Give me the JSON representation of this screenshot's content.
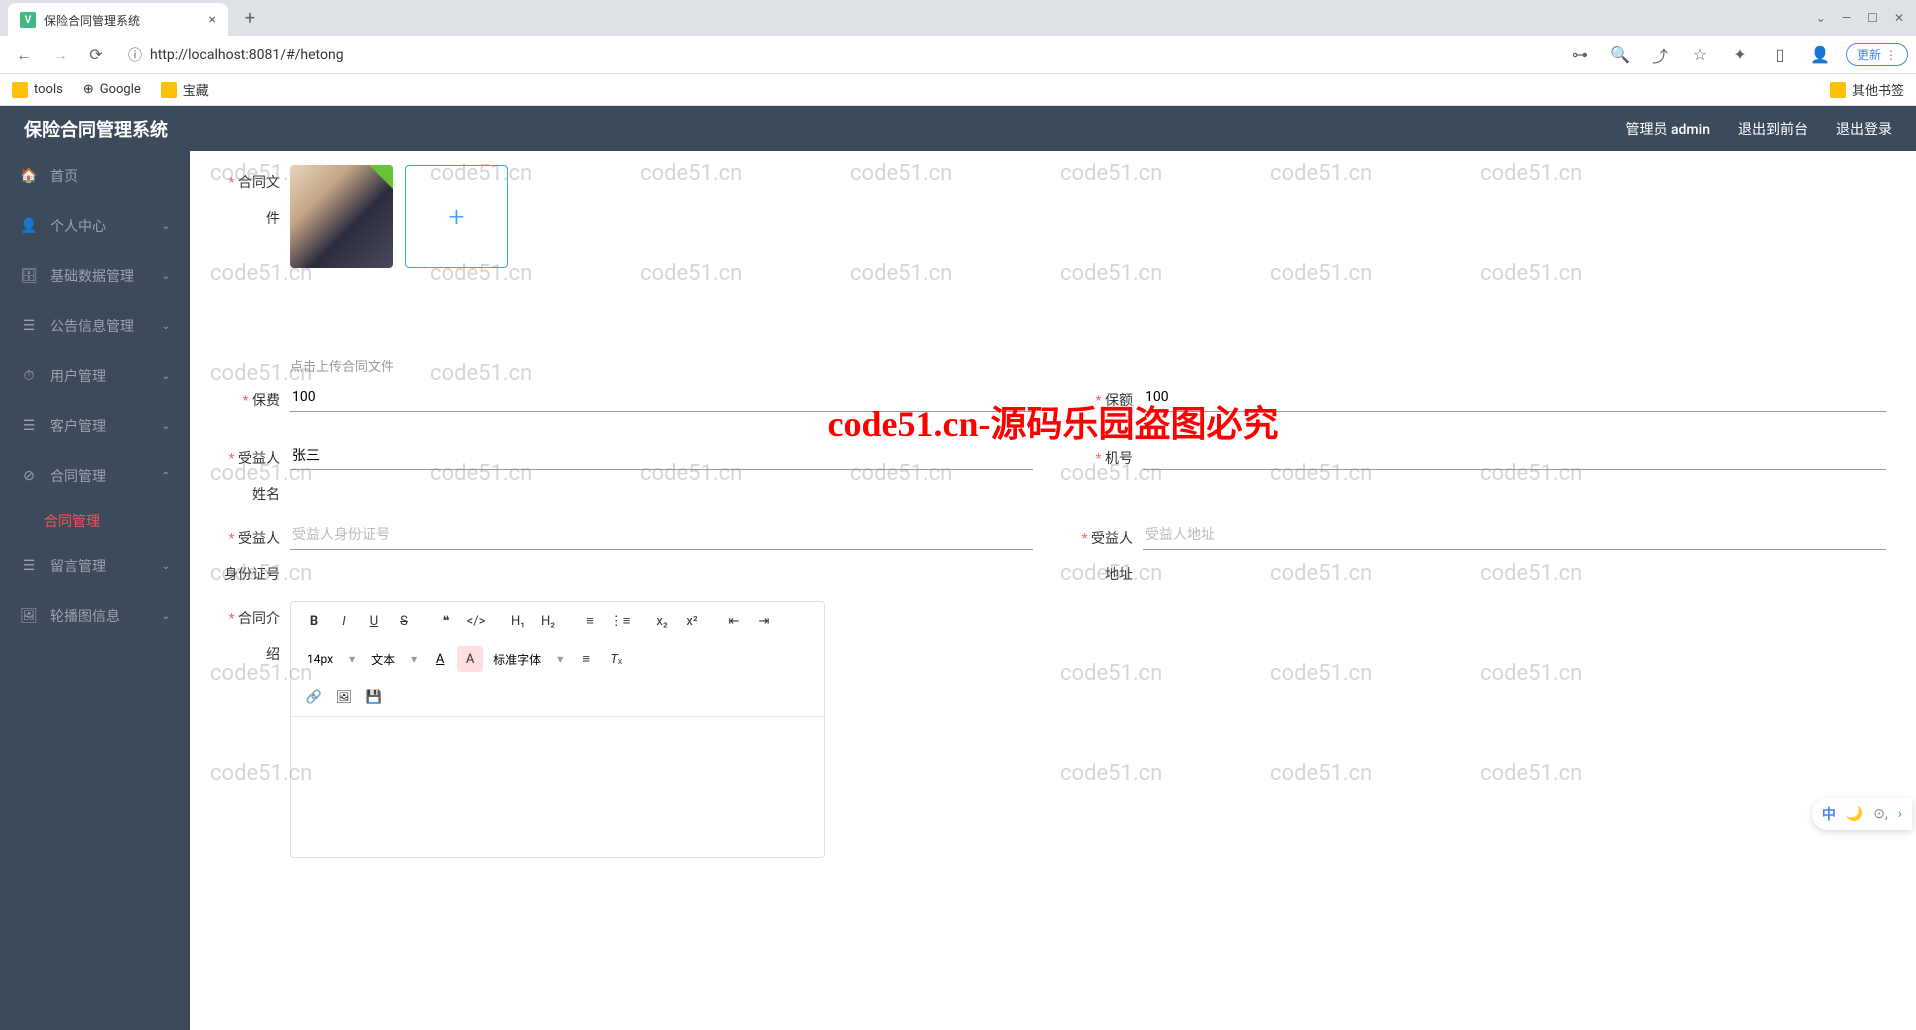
{
  "browser": {
    "tab_title": "保险合同管理系统",
    "url": "http://localhost:8081/#/hetong",
    "update_label": "更新",
    "bookmarks": {
      "tools": "tools",
      "google": "Google",
      "treasure": "宝藏",
      "other": "其他书签"
    }
  },
  "header": {
    "title": "保险合同管理系统",
    "admin": "管理员 admin",
    "to_front": "退出到前台",
    "logout": "退出登录"
  },
  "sidebar": {
    "home": "首页",
    "personal": "个人中心",
    "base_data": "基础数据管理",
    "announce": "公告信息管理",
    "user_mgmt": "用户管理",
    "customer_mgmt": "客户管理",
    "contract_mgmt": "合同管理",
    "contract_manage": "合同管理",
    "message_mgmt": "留言管理",
    "carousel": "轮播图信息"
  },
  "form": {
    "file_label": "合同文件",
    "file_tip": "点击上传合同文件",
    "premium_label": "保费",
    "premium_value": "100",
    "amount_label": "保额",
    "amount_value": "100",
    "beneficiary_name_label": "受益人姓名",
    "beneficiary_name_value": "张三",
    "phone_label": "机号",
    "beneficiary_id_label": "受益人身份证号",
    "beneficiary_id_placeholder": "受益人身份证号",
    "beneficiary_addr_label": "受益人地址",
    "beneficiary_addr_placeholder": "受益人地址",
    "intro_label": "合同介绍"
  },
  "editor": {
    "font_size": "14px",
    "font_type": "文本",
    "font_family": "标准字体"
  },
  "watermark": {
    "center": "code51.cn-源码乐园盗图必究",
    "bg": "code51.cn"
  },
  "ime": {
    "lang": "中"
  }
}
